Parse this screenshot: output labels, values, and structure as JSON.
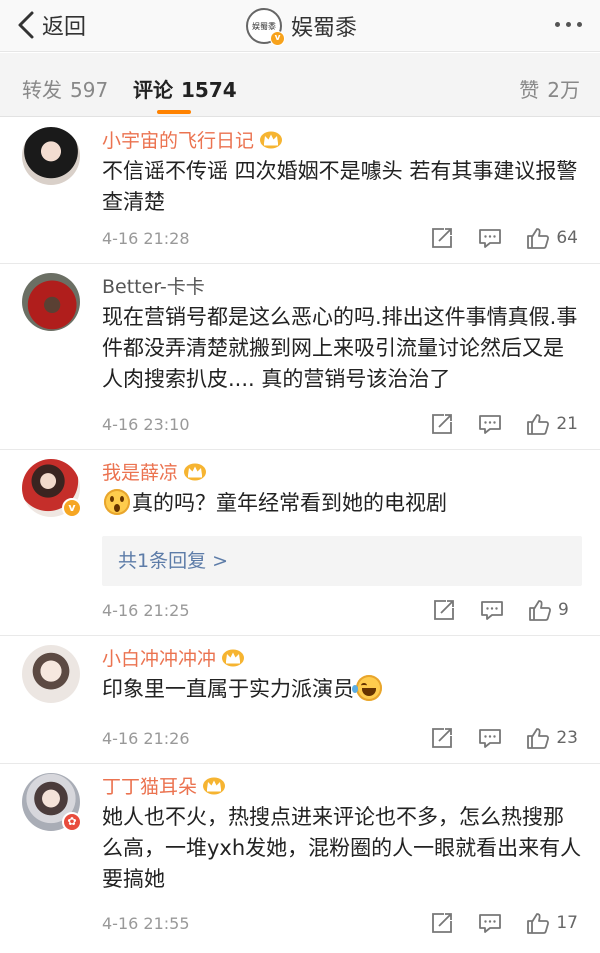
{
  "nav": {
    "back_label": "返回",
    "avatar_text": "娱蜀黍",
    "title": "娱蜀黍"
  },
  "tabs": {
    "repost": {
      "label": "转发",
      "count": "597"
    },
    "comment": {
      "label": "评论",
      "count": "1574"
    },
    "like": {
      "label": "赞",
      "count": "2万"
    }
  },
  "colors": {
    "accent": "#ff8200",
    "username": "#eb7350",
    "link": "#5d7ca8"
  },
  "comments": [
    {
      "username": "小宇宙的飞行日记",
      "verified_crown": true,
      "text": "不信谣不传谣 四次婚姻不是噱头 若有其事建议报警查清楚",
      "time": "4-16 21:28",
      "likes": "64"
    },
    {
      "username": "Better-卡卡",
      "verified_crown": false,
      "text": "现在营销号都是这么恶心的吗.排出这件事情真假.事件都没弄清楚就搬到网上来吸引流量讨论然后又是人肉搜索扒皮.... 真的营销号该治治了",
      "time": "4-16 23:10",
      "likes": "21"
    },
    {
      "username": "我是薛凉",
      "verified_crown": true,
      "avatar_badge": "gold-v",
      "emoji": "surprised-emoji",
      "text": "真的吗？童年经常看到她的电视剧",
      "reply_summary": "共1条回复 >",
      "time": "4-16 21:25",
      "likes": "9"
    },
    {
      "username": "小白冲冲冲冲",
      "verified_crown": true,
      "text": "印象里一直属于实力派演员",
      "emoji": "laugh-cry-emoji",
      "time": "4-16 21:26",
      "likes": "23"
    },
    {
      "username": "丁丁猫耳朵",
      "verified_crown": true,
      "avatar_badge": "red-flower",
      "text": "她人也不火，热搜点进来评论也不多，怎么热搜那么高，一堆yxh发她，混粉圈的人一眼就看出来有人要搞她",
      "time": "4-16 21:55",
      "likes": "17"
    }
  ],
  "icons": [
    "chevron-left-icon",
    "more-dots-icon",
    "crown-icon",
    "repost-icon",
    "comment-icon",
    "like-icon"
  ]
}
